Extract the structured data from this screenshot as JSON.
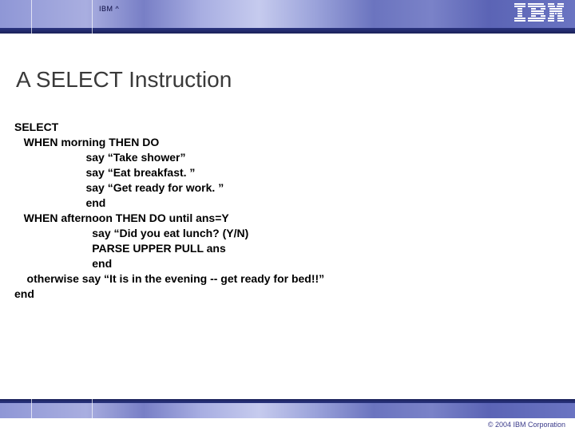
{
  "header": {
    "brand_small": "IBM ^",
    "logo_label": "IBM"
  },
  "slide": {
    "title": "A SELECT Instruction",
    "code": "SELECT\n   WHEN morning THEN DO\n                       say “Take shower”\n                       say “Eat breakfast. ”\n                       say “Get ready for work. ”\n                       end\n   WHEN afternoon THEN DO until ans=Y\n                         say “Did you eat lunch? (Y/N)\n                         PARSE UPPER PULL ans\n                         end\n    otherwise say “It is in the evening -- get ready for bed!!”\nend"
  },
  "footer": {
    "copyright": "© 2004 IBM Corporation"
  }
}
